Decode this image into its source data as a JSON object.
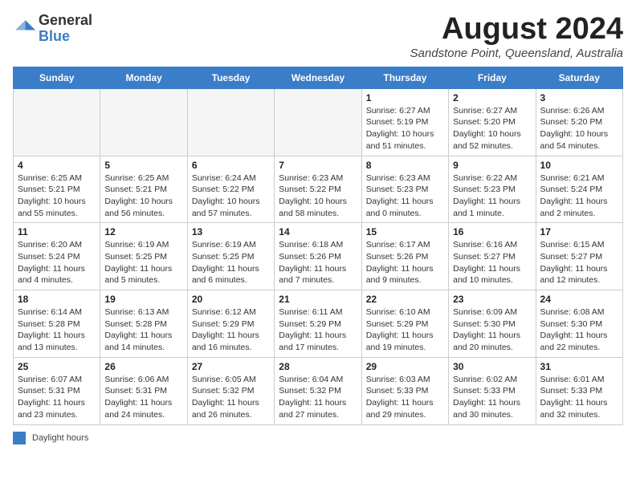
{
  "logo": {
    "general": "General",
    "blue": "Blue"
  },
  "title": "August 2024",
  "subtitle": "Sandstone Point, Queensland, Australia",
  "weekdays": [
    "Sunday",
    "Monday",
    "Tuesday",
    "Wednesday",
    "Thursday",
    "Friday",
    "Saturday"
  ],
  "legend": {
    "box_color": "#3a7dc9",
    "label": "Daylight hours"
  },
  "weeks": [
    [
      {
        "day": "",
        "info": ""
      },
      {
        "day": "",
        "info": ""
      },
      {
        "day": "",
        "info": ""
      },
      {
        "day": "",
        "info": ""
      },
      {
        "day": "1",
        "info": "Sunrise: 6:27 AM\nSunset: 5:19 PM\nDaylight: 10 hours and 51 minutes."
      },
      {
        "day": "2",
        "info": "Sunrise: 6:27 AM\nSunset: 5:20 PM\nDaylight: 10 hours and 52 minutes."
      },
      {
        "day": "3",
        "info": "Sunrise: 6:26 AM\nSunset: 5:20 PM\nDaylight: 10 hours and 54 minutes."
      }
    ],
    [
      {
        "day": "4",
        "info": "Sunrise: 6:25 AM\nSunset: 5:21 PM\nDaylight: 10 hours and 55 minutes."
      },
      {
        "day": "5",
        "info": "Sunrise: 6:25 AM\nSunset: 5:21 PM\nDaylight: 10 hours and 56 minutes."
      },
      {
        "day": "6",
        "info": "Sunrise: 6:24 AM\nSunset: 5:22 PM\nDaylight: 10 hours and 57 minutes."
      },
      {
        "day": "7",
        "info": "Sunrise: 6:23 AM\nSunset: 5:22 PM\nDaylight: 10 hours and 58 minutes."
      },
      {
        "day": "8",
        "info": "Sunrise: 6:23 AM\nSunset: 5:23 PM\nDaylight: 11 hours and 0 minutes."
      },
      {
        "day": "9",
        "info": "Sunrise: 6:22 AM\nSunset: 5:23 PM\nDaylight: 11 hours and 1 minute."
      },
      {
        "day": "10",
        "info": "Sunrise: 6:21 AM\nSunset: 5:24 PM\nDaylight: 11 hours and 2 minutes."
      }
    ],
    [
      {
        "day": "11",
        "info": "Sunrise: 6:20 AM\nSunset: 5:24 PM\nDaylight: 11 hours and 4 minutes."
      },
      {
        "day": "12",
        "info": "Sunrise: 6:19 AM\nSunset: 5:25 PM\nDaylight: 11 hours and 5 minutes."
      },
      {
        "day": "13",
        "info": "Sunrise: 6:19 AM\nSunset: 5:25 PM\nDaylight: 11 hours and 6 minutes."
      },
      {
        "day": "14",
        "info": "Sunrise: 6:18 AM\nSunset: 5:26 PM\nDaylight: 11 hours and 7 minutes."
      },
      {
        "day": "15",
        "info": "Sunrise: 6:17 AM\nSunset: 5:26 PM\nDaylight: 11 hours and 9 minutes."
      },
      {
        "day": "16",
        "info": "Sunrise: 6:16 AM\nSunset: 5:27 PM\nDaylight: 11 hours and 10 minutes."
      },
      {
        "day": "17",
        "info": "Sunrise: 6:15 AM\nSunset: 5:27 PM\nDaylight: 11 hours and 12 minutes."
      }
    ],
    [
      {
        "day": "18",
        "info": "Sunrise: 6:14 AM\nSunset: 5:28 PM\nDaylight: 11 hours and 13 minutes."
      },
      {
        "day": "19",
        "info": "Sunrise: 6:13 AM\nSunset: 5:28 PM\nDaylight: 11 hours and 14 minutes."
      },
      {
        "day": "20",
        "info": "Sunrise: 6:12 AM\nSunset: 5:29 PM\nDaylight: 11 hours and 16 minutes."
      },
      {
        "day": "21",
        "info": "Sunrise: 6:11 AM\nSunset: 5:29 PM\nDaylight: 11 hours and 17 minutes."
      },
      {
        "day": "22",
        "info": "Sunrise: 6:10 AM\nSunset: 5:29 PM\nDaylight: 11 hours and 19 minutes."
      },
      {
        "day": "23",
        "info": "Sunrise: 6:09 AM\nSunset: 5:30 PM\nDaylight: 11 hours and 20 minutes."
      },
      {
        "day": "24",
        "info": "Sunrise: 6:08 AM\nSunset: 5:30 PM\nDaylight: 11 hours and 22 minutes."
      }
    ],
    [
      {
        "day": "25",
        "info": "Sunrise: 6:07 AM\nSunset: 5:31 PM\nDaylight: 11 hours and 23 minutes."
      },
      {
        "day": "26",
        "info": "Sunrise: 6:06 AM\nSunset: 5:31 PM\nDaylight: 11 hours and 24 minutes."
      },
      {
        "day": "27",
        "info": "Sunrise: 6:05 AM\nSunset: 5:32 PM\nDaylight: 11 hours and 26 minutes."
      },
      {
        "day": "28",
        "info": "Sunrise: 6:04 AM\nSunset: 5:32 PM\nDaylight: 11 hours and 27 minutes."
      },
      {
        "day": "29",
        "info": "Sunrise: 6:03 AM\nSunset: 5:33 PM\nDaylight: 11 hours and 29 minutes."
      },
      {
        "day": "30",
        "info": "Sunrise: 6:02 AM\nSunset: 5:33 PM\nDaylight: 11 hours and 30 minutes."
      },
      {
        "day": "31",
        "info": "Sunrise: 6:01 AM\nSunset: 5:33 PM\nDaylight: 11 hours and 32 minutes."
      }
    ]
  ]
}
